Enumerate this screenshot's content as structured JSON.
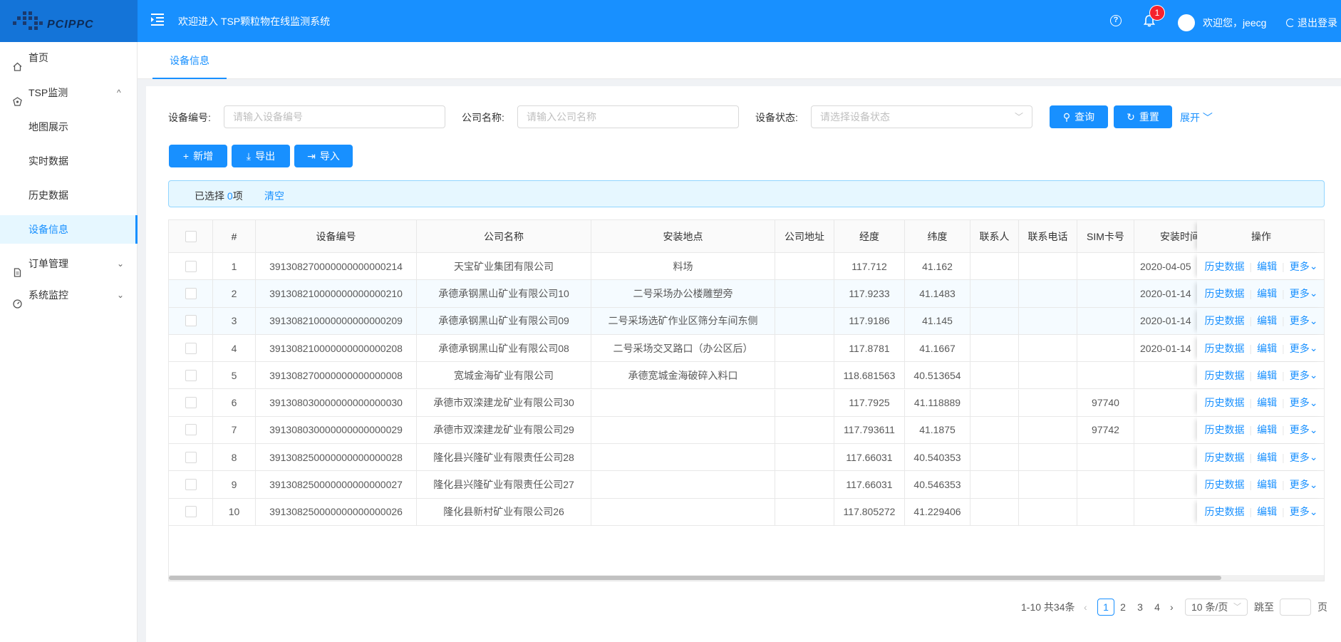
{
  "header": {
    "brand": "PCIPPC",
    "title": "欢迎进入 TSP颗粒物在线监测系统",
    "notification_count": "1",
    "welcome": "欢迎您，jeecg",
    "logout": "退出登录"
  },
  "sidebar": {
    "items": [
      {
        "label": "首页",
        "icon": "home-icon"
      },
      {
        "label": "TSP监测",
        "icon": "monitor-icon"
      },
      {
        "label": "地图展示"
      },
      {
        "label": "实时数据"
      },
      {
        "label": "历史数据"
      },
      {
        "label": "设备信息"
      },
      {
        "label": "订单管理",
        "icon": "file-icon"
      },
      {
        "label": "系统监控",
        "icon": "dashboard-icon"
      }
    ]
  },
  "tabs": [
    {
      "label": "设备信息"
    }
  ],
  "filters": {
    "device_no_label": "设备编号:",
    "device_no_placeholder": "请输入设备编号",
    "company_label": "公司名称:",
    "company_placeholder": "请输入公司名称",
    "status_label": "设备状态:",
    "status_placeholder": "请选择设备状态",
    "query": "查询",
    "reset": "重置",
    "expand": "展开"
  },
  "toolbar": {
    "add": "新增",
    "export": "导出",
    "import": "导入"
  },
  "selection": {
    "prefix": "已选择",
    "count": "0",
    "suffix": "项",
    "clear": "清空"
  },
  "table": {
    "columns": [
      "#",
      "设备编号",
      "公司名称",
      "安装地点",
      "公司地址",
      "经度",
      "纬度",
      "联系人",
      "联系电话",
      "SIM卡号",
      "安装时间",
      "操作"
    ],
    "ops": {
      "history": "历史数据",
      "edit": "编辑",
      "more": "更多"
    },
    "rows": [
      {
        "no": "1",
        "device": "391308270000000000000214",
        "company": "天宝矿业集团有限公司",
        "location": "料场",
        "address": "",
        "lng": "117.712",
        "lat": "41.162",
        "contact": "",
        "phone": "",
        "sim": "",
        "time": "2020-04-05"
      },
      {
        "no": "2",
        "device": "391308210000000000000210",
        "company": "承德承钢黑山矿业有限公司10",
        "location": "二号采场办公楼雕塑旁",
        "address": "",
        "lng": "117.9233",
        "lat": "41.1483",
        "contact": "",
        "phone": "",
        "sim": "",
        "time": "2020-01-14"
      },
      {
        "no": "3",
        "device": "391308210000000000000209",
        "company": "承德承钢黑山矿业有限公司09",
        "location": "二号采场选矿作业区筛分车间东侧",
        "address": "",
        "lng": "117.9186",
        "lat": "41.145",
        "contact": "",
        "phone": "",
        "sim": "",
        "time": "2020-01-14"
      },
      {
        "no": "4",
        "device": "391308210000000000000208",
        "company": "承德承钢黑山矿业有限公司08",
        "location": "二号采场交叉路口（办公区后）",
        "address": "",
        "lng": "117.8781",
        "lat": "41.1667",
        "contact": "",
        "phone": "",
        "sim": "",
        "time": "2020-01-14"
      },
      {
        "no": "5",
        "device": "391308270000000000000008",
        "company": "宽城金海矿业有限公司",
        "location": "承德宽城金海破碎入料口",
        "address": "",
        "lng": "118.681563",
        "lat": "40.513654",
        "contact": "",
        "phone": "",
        "sim": "",
        "time": ""
      },
      {
        "no": "6",
        "device": "391308030000000000000030",
        "company": "承德市双滦建龙矿业有限公司30",
        "location": "",
        "address": "",
        "lng": "117.7925",
        "lat": "41.118889",
        "contact": "",
        "phone": "",
        "sim": "97740",
        "time": ""
      },
      {
        "no": "7",
        "device": "391308030000000000000029",
        "company": "承德市双滦建龙矿业有限公司29",
        "location": "",
        "address": "",
        "lng": "117.793611",
        "lat": "41.1875",
        "contact": "",
        "phone": "",
        "sim": "97742",
        "time": ""
      },
      {
        "no": "8",
        "device": "391308250000000000000028",
        "company": "隆化县兴隆矿业有限责任公司28",
        "location": "",
        "address": "",
        "lng": "117.66031",
        "lat": "40.540353",
        "contact": "",
        "phone": "",
        "sim": "",
        "time": ""
      },
      {
        "no": "9",
        "device": "391308250000000000000027",
        "company": "隆化县兴隆矿业有限责任公司27",
        "location": "",
        "address": "",
        "lng": "117.66031",
        "lat": "40.546353",
        "contact": "",
        "phone": "",
        "sim": "",
        "time": ""
      },
      {
        "no": "10",
        "device": "391308250000000000000026",
        "company": "隆化县新村矿业有限公司26",
        "location": "",
        "address": "",
        "lng": "117.805272",
        "lat": "41.229406",
        "contact": "",
        "phone": "",
        "sim": "",
        "time": ""
      }
    ]
  },
  "pagination": {
    "total": "1-10 共34条",
    "pages": [
      "1",
      "2",
      "3",
      "4"
    ],
    "current": "1",
    "page_size": "10 条/页",
    "jump_label": "跳至",
    "page_label": "页"
  },
  "colors": {
    "primary": "#1890ff",
    "badge": "#f5222d"
  }
}
